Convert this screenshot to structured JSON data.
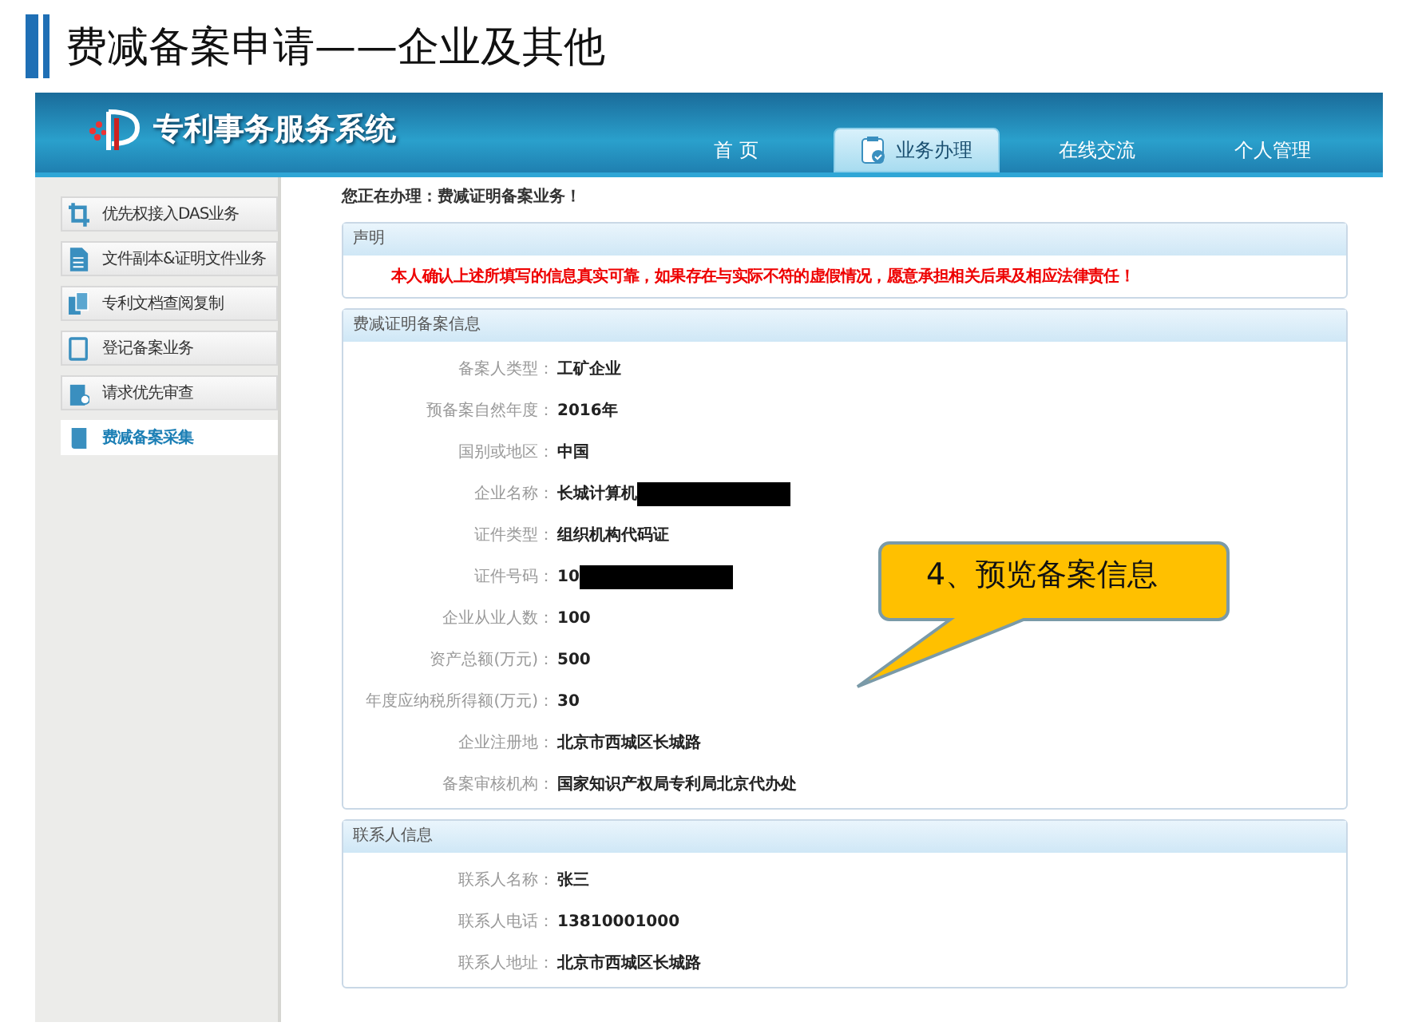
{
  "slide_title": "费减备案申请——企业及其他",
  "app": {
    "logo_text": "专利事务服务系统",
    "tabs": [
      {
        "label": "首 页",
        "selected": false
      },
      {
        "label": "业务办理",
        "selected": true
      },
      {
        "label": "在线交流",
        "selected": false
      },
      {
        "label": "个人管理",
        "selected": false
      }
    ]
  },
  "sidebar": {
    "items": [
      {
        "label": "优先权接入DAS业务",
        "selected": false
      },
      {
        "label": "文件副本&证明文件业务",
        "selected": false
      },
      {
        "label": "专利文档查阅复制",
        "selected": false
      },
      {
        "label": "登记备案业务",
        "selected": false
      },
      {
        "label": "请求优先审查",
        "selected": false
      },
      {
        "label": "费减备案采集",
        "selected": true
      }
    ]
  },
  "current_task": "您正在办理：费减证明备案业务！",
  "declaration": {
    "title": "声明",
    "text": "本人确认上述所填写的信息真实可靠，如果存在与实际不符的虚假情况，愿意承担相关后果及相应法律责任！"
  },
  "filing_info": {
    "title": "费减证明备案信息",
    "fields": [
      {
        "label": "备案人类型：",
        "value": "工矿企业",
        "redacted": false
      },
      {
        "label": "预备案自然年度：",
        "value": "2016年",
        "redacted": false
      },
      {
        "label": "国别或地区：",
        "value": "中国",
        "redacted": false
      },
      {
        "label": "企业名称：",
        "value": "长城计算机",
        "redacted": true
      },
      {
        "label": "证件类型：",
        "value": "组织机构代码证",
        "redacted": false
      },
      {
        "label": "证件号码：",
        "value": "10",
        "redacted": true
      },
      {
        "label": "企业从业人数：",
        "value": "100",
        "redacted": false
      },
      {
        "label": "资产总额(万元)：",
        "value": "500",
        "redacted": false
      },
      {
        "label": "年度应纳税所得额(万元)：",
        "value": "30",
        "redacted": false
      },
      {
        "label": "企业注册地：",
        "value": "北京市西城区长城路",
        "redacted": false
      },
      {
        "label": "备案审核机构：",
        "value": "国家知识产权局专利局北京代办处",
        "redacted": false
      }
    ]
  },
  "contact_info": {
    "title": "联系人信息",
    "fields": [
      {
        "label": "联系人名称：",
        "value": "张三",
        "redacted": false
      },
      {
        "label": "联系人电话：",
        "value": "13810001000",
        "redacted": false
      },
      {
        "label": "联系人地址：",
        "value": "北京市西城区长城路",
        "redacted": false
      }
    ]
  },
  "callout": {
    "text": "4、预览备案信息"
  }
}
